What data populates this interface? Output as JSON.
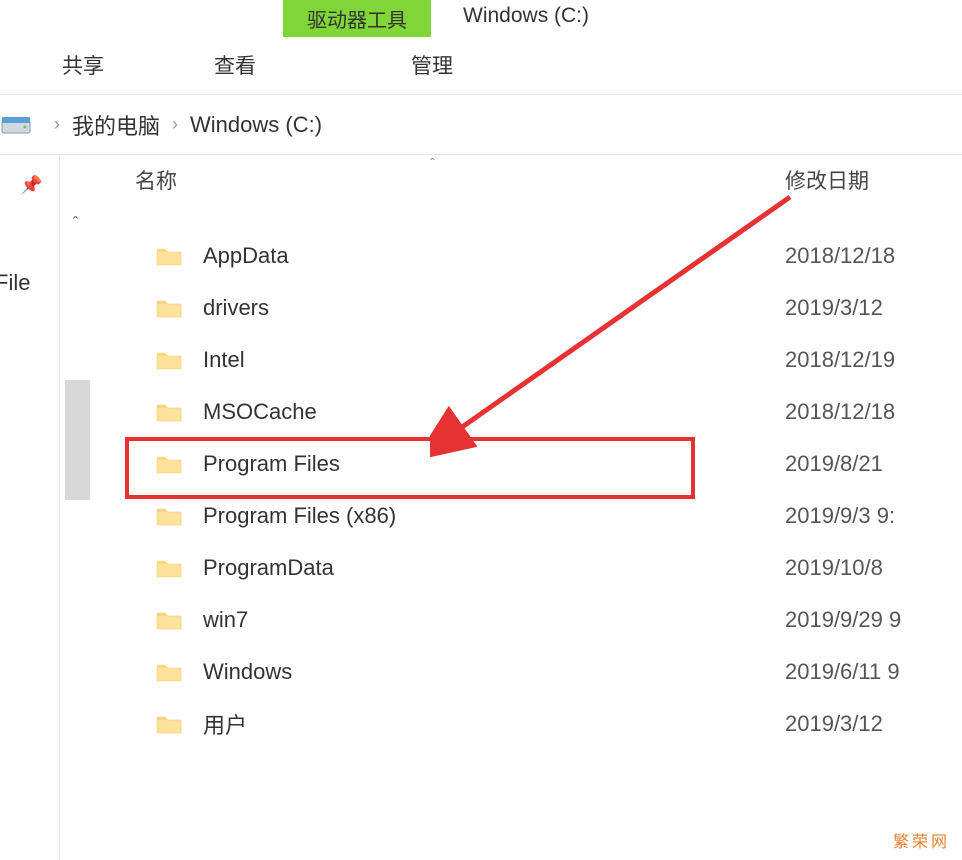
{
  "titleBar": {
    "driveTools": "驱动器工具",
    "windowTitle": "Windows (C:)"
  },
  "tabs": {
    "share": "共享",
    "view": "查看",
    "manage": "管理"
  },
  "breadcrumb": {
    "myComputer": "我的电脑",
    "drive": "Windows (C:)"
  },
  "columns": {
    "name": "名称",
    "date": "修改日期"
  },
  "sidebar": {
    "fileText": "File"
  },
  "files": [
    {
      "name": "AppData",
      "date": "2018/12/18"
    },
    {
      "name": "drivers",
      "date": "2019/3/12"
    },
    {
      "name": "Intel",
      "date": "2018/12/19"
    },
    {
      "name": "MSOCache",
      "date": "2018/12/18"
    },
    {
      "name": "Program Files",
      "date": "2019/8/21"
    },
    {
      "name": "Program Files (x86)",
      "date": "2019/9/3 9:"
    },
    {
      "name": "ProgramData",
      "date": "2019/10/8"
    },
    {
      "name": "win7",
      "date": "2019/9/29 9"
    },
    {
      "name": "Windows",
      "date": "2019/6/11 9"
    },
    {
      "name": "用户",
      "date": "2019/3/12"
    }
  ],
  "annotation": {
    "highlightedIndex": 4
  },
  "watermark": "繁荣网"
}
